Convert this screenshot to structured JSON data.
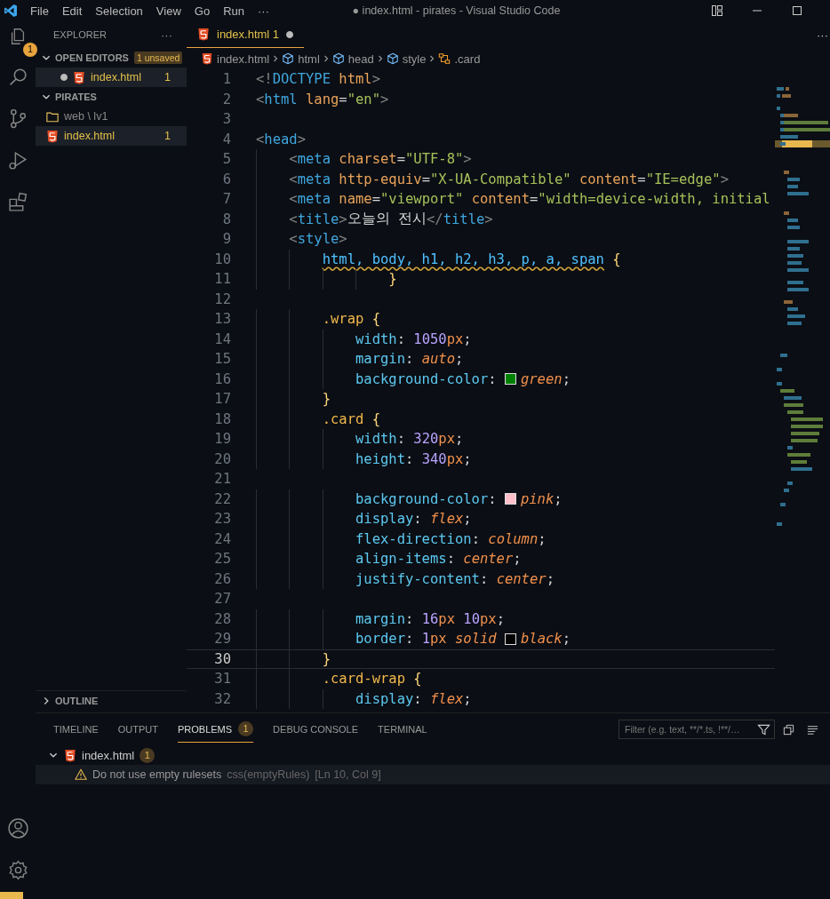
{
  "title_bar": {
    "menu": [
      "File",
      "Edit",
      "Selection",
      "View",
      "Go",
      "Run",
      "···"
    ],
    "title": "● index.html - pirates - Visual Studio Code"
  },
  "activity_bar": {
    "explorer_badge": "1"
  },
  "sidebar": {
    "title": "EXPLORER",
    "more": "···",
    "sections": [
      {
        "label": "OPEN EDITORS",
        "expanded": true,
        "badge": "1 unsaved",
        "items": [
          {
            "kind": "html",
            "name": "index.html",
            "count": "1",
            "dirty": true
          }
        ]
      },
      {
        "label": "PIRATES",
        "expanded": true,
        "items": [
          {
            "kind": "folder",
            "name": "web \\ lv1",
            "selected": false
          },
          {
            "kind": "html",
            "name": "index.html",
            "count": "1",
            "selected": true
          }
        ]
      },
      {
        "label": "OUTLINE",
        "expanded": false
      }
    ]
  },
  "tab": {
    "name": "index.html",
    "count": "1",
    "dirty": true
  },
  "editor_more": "···",
  "breadcrumbs": [
    {
      "kind": "file",
      "text": "index.html"
    },
    {
      "kind": "element",
      "text": "html"
    },
    {
      "kind": "element",
      "text": "head"
    },
    {
      "kind": "element",
      "text": "style"
    },
    {
      "kind": "selector",
      "text": ".card"
    }
  ],
  "lines": [
    {
      "n": "1",
      "current": false,
      "tokens": [
        {
          "kind": "punct",
          "text": "<!"
        },
        {
          "kind": "tag",
          "text": "DOCTYPE"
        },
        {
          "kind": "attr",
          "text": " html"
        },
        {
          "kind": "punct",
          "text": ">"
        }
      ]
    },
    {
      "n": "2",
      "current": false,
      "tokens": [
        {
          "kind": "punct",
          "text": "<"
        },
        {
          "kind": "tag",
          "text": "html"
        },
        {
          "kind": "attr",
          "text": " lang"
        },
        {
          "kind": "text",
          "text": "="
        },
        {
          "kind": "str",
          "text": "\"en\""
        },
        {
          "kind": "punct",
          "text": ">"
        }
      ]
    },
    {
      "n": "3",
      "current": false
    },
    {
      "n": "4",
      "current": false,
      "tokens": [
        {
          "kind": "punct",
          "text": "<"
        },
        {
          "kind": "tag",
          "text": "head"
        },
        {
          "kind": "punct",
          "text": ">"
        }
      ]
    },
    {
      "n": "5",
      "current": false,
      "tokens": [
        {
          "kind": "punct",
          "text": "    <"
        },
        {
          "kind": "tag",
          "text": "meta"
        },
        {
          "kind": "attr",
          "text": " charset"
        },
        {
          "kind": "text",
          "text": "="
        },
        {
          "kind": "str",
          "text": "\"UTF-8\""
        },
        {
          "kind": "punct",
          "text": ">"
        }
      ]
    },
    {
      "n": "6",
      "current": false,
      "tokens": [
        {
          "kind": "punct",
          "text": "    <"
        },
        {
          "kind": "tag",
          "text": "meta"
        },
        {
          "kind": "attr",
          "text": " http-equiv"
        },
        {
          "kind": "text",
          "text": "="
        },
        {
          "kind": "str",
          "text": "\"X-UA-Compatible\""
        },
        {
          "kind": "attr",
          "text": " content"
        },
        {
          "kind": "text",
          "text": "="
        },
        {
          "kind": "str",
          "text": "\"IE=edge\""
        },
        {
          "kind": "punct",
          "text": ">"
        }
      ]
    },
    {
      "n": "7",
      "current": false,
      "tokens": [
        {
          "kind": "punct",
          "text": "    <"
        },
        {
          "kind": "tag",
          "text": "meta"
        },
        {
          "kind": "attr",
          "text": " name"
        },
        {
          "kind": "text",
          "text": "="
        },
        {
          "kind": "str",
          "text": "\"viewport\""
        },
        {
          "kind": "attr",
          "text": " content"
        },
        {
          "kind": "text",
          "text": "="
        },
        {
          "kind": "str",
          "text": "\"width=device-width, initial"
        }
      ]
    },
    {
      "n": "8",
      "current": false,
      "tokens": [
        {
          "kind": "punct",
          "text": "    <"
        },
        {
          "kind": "tag",
          "text": "title"
        },
        {
          "kind": "punct",
          "text": ">"
        },
        {
          "kind": "text",
          "text": "오늘의 전시"
        },
        {
          "kind": "punct",
          "text": "</"
        },
        {
          "kind": "tag",
          "text": "title"
        },
        {
          "kind": "punct",
          "text": ">"
        }
      ]
    },
    {
      "n": "9",
      "current": false,
      "tokens": [
        {
          "kind": "punct",
          "text": "    <"
        },
        {
          "kind": "tag",
          "text": "style"
        },
        {
          "kind": "punct",
          "text": ">"
        }
      ]
    },
    {
      "n": "10",
      "current": false,
      "tokens": [
        {
          "kind": "squiggle",
          "text": "        html, body, h1, h2, h3, p, a, span"
        },
        {
          "kind": "brace",
          "text": " {"
        }
      ]
    },
    {
      "n": "11",
      "current": false,
      "tokens": [
        {
          "kind": "brace",
          "text": "                }"
        }
      ]
    },
    {
      "n": "12",
      "current": false
    },
    {
      "n": "13",
      "current": false,
      "tokens": [
        {
          "kind": "cls",
          "text": "        .wrap"
        },
        {
          "kind": "brace",
          "text": " {"
        }
      ]
    },
    {
      "n": "14",
      "current": false,
      "tokens": [
        {
          "kind": "prop",
          "text": "            width"
        },
        {
          "kind": "text",
          "text": ": "
        },
        {
          "kind": "num",
          "text": "1050"
        },
        {
          "kind": "unit",
          "text": "px"
        },
        {
          "kind": "text",
          "text": ";"
        }
      ]
    },
    {
      "n": "15",
      "current": false,
      "tokens": [
        {
          "kind": "prop",
          "text": "            margin"
        },
        {
          "kind": "text",
          "text": ": "
        },
        {
          "kind": "val",
          "text": "auto"
        },
        {
          "kind": "text",
          "text": ";"
        }
      ]
    },
    {
      "n": "16",
      "current": false,
      "tokens": [
        {
          "kind": "prop",
          "text": "            background-color"
        },
        {
          "kind": "text",
          "text": ": "
        },
        {
          "kind": "swatch",
          "color": "#008000"
        },
        {
          "kind": "val",
          "text": "green"
        },
        {
          "kind": "text",
          "text": ";"
        }
      ]
    },
    {
      "n": "17",
      "current": false,
      "tokens": [
        {
          "kind": "brace",
          "text": "        }"
        }
      ]
    },
    {
      "n": "18",
      "current": false,
      "tokens": [
        {
          "kind": "cls",
          "text": "        .card"
        },
        {
          "kind": "brace",
          "text": " {"
        }
      ]
    },
    {
      "n": "19",
      "current": false,
      "tokens": [
        {
          "kind": "prop",
          "text": "            width"
        },
        {
          "kind": "text",
          "text": ": "
        },
        {
          "kind": "num",
          "text": "320"
        },
        {
          "kind": "unit",
          "text": "px"
        },
        {
          "kind": "text",
          "text": ";"
        }
      ]
    },
    {
      "n": "20",
      "current": false,
      "tokens": [
        {
          "kind": "prop",
          "text": "            height"
        },
        {
          "kind": "text",
          "text": ": "
        },
        {
          "kind": "num",
          "text": "340"
        },
        {
          "kind": "unit",
          "text": "px"
        },
        {
          "kind": "text",
          "text": ";"
        }
      ]
    },
    {
      "n": "21",
      "current": false
    },
    {
      "n": "22",
      "current": false,
      "tokens": [
        {
          "kind": "prop",
          "text": "            background-color"
        },
        {
          "kind": "text",
          "text": ": "
        },
        {
          "kind": "swatch",
          "color": "#ffc0cb"
        },
        {
          "kind": "val",
          "text": "pink"
        },
        {
          "kind": "text",
          "text": ";"
        }
      ]
    },
    {
      "n": "23",
      "current": false,
      "tokens": [
        {
          "kind": "prop",
          "text": "            display"
        },
        {
          "kind": "text",
          "text": ": "
        },
        {
          "kind": "val",
          "text": "flex"
        },
        {
          "kind": "text",
          "text": ";"
        }
      ]
    },
    {
      "n": "24",
      "current": false,
      "tokens": [
        {
          "kind": "prop",
          "text": "            flex-direction"
        },
        {
          "kind": "text",
          "text": ": "
        },
        {
          "kind": "val",
          "text": "column"
        },
        {
          "kind": "text",
          "text": ";"
        }
      ]
    },
    {
      "n": "25",
      "current": false,
      "tokens": [
        {
          "kind": "prop",
          "text": "            align-items"
        },
        {
          "kind": "text",
          "text": ": "
        },
        {
          "kind": "val",
          "text": "center"
        },
        {
          "kind": "text",
          "text": ";"
        }
      ]
    },
    {
      "n": "26",
      "current": false,
      "tokens": [
        {
          "kind": "prop",
          "text": "            justify-content"
        },
        {
          "kind": "text",
          "text": ": "
        },
        {
          "kind": "val",
          "text": "center"
        },
        {
          "kind": "text",
          "text": ";"
        }
      ]
    },
    {
      "n": "27",
      "current": false
    },
    {
      "n": "28",
      "current": false,
      "tokens": [
        {
          "kind": "prop",
          "text": "            margin"
        },
        {
          "kind": "text",
          "text": ": "
        },
        {
          "kind": "num",
          "text": "16"
        },
        {
          "kind": "unit",
          "text": "px"
        },
        {
          "kind": "num",
          "text": " 10"
        },
        {
          "kind": "unit",
          "text": "px"
        },
        {
          "kind": "text",
          "text": ";"
        }
      ]
    },
    {
      "n": "29",
      "current": false,
      "tokens": [
        {
          "kind": "prop",
          "text": "            border"
        },
        {
          "kind": "text",
          "text": ": "
        },
        {
          "kind": "num",
          "text": "1"
        },
        {
          "kind": "unit",
          "text": "px"
        },
        {
          "kind": "val",
          "text": " solid "
        },
        {
          "kind": "swatch",
          "color": "#000000"
        },
        {
          "kind": "val",
          "text": "black"
        },
        {
          "kind": "text",
          "text": ";"
        }
      ]
    },
    {
      "n": "30",
      "current": true,
      "tokens": [
        {
          "kind": "brace",
          "text": "        }"
        }
      ]
    },
    {
      "n": "31",
      "current": false,
      "tokens": [
        {
          "kind": "cls",
          "text": "        .card-wrap"
        },
        {
          "kind": "brace",
          "text": " {"
        }
      ]
    },
    {
      "n": "32",
      "current": false,
      "tokens": [
        {
          "kind": "prop",
          "text": "            display"
        },
        {
          "kind": "text",
          "text": ": "
        },
        {
          "kind": "val",
          "text": "flex"
        },
        {
          "kind": "text",
          "text": ";"
        }
      ]
    }
  ],
  "panel": {
    "tabs": [
      {
        "label": "TIMELINE",
        "selected": false
      },
      {
        "label": "OUTPUT",
        "selected": false
      },
      {
        "label": "PROBLEMS",
        "selected": true,
        "badge": "1"
      },
      {
        "label": "DEBUG CONSOLE",
        "selected": false
      },
      {
        "label": "TERMINAL",
        "selected": false
      }
    ],
    "filter": {
      "placeholder": "Filter (e.g. text, **/*.ts, !**/…"
    },
    "problems": [
      {
        "file": "index.html",
        "count": "1",
        "expanded": true,
        "messages": [
          {
            "kind": "warning",
            "text": "Do not use empty rulesets",
            "source": "css(emptyRules)",
            "location": "[Ln 10, Col 9]"
          }
        ]
      }
    ]
  }
}
